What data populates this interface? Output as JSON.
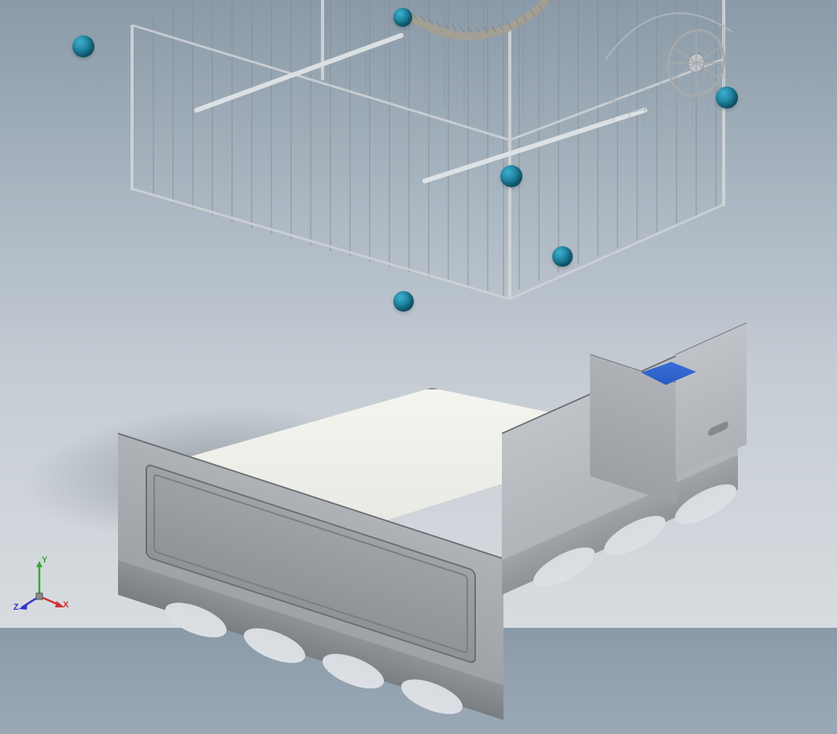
{
  "viewport": {
    "background_top": "#8a9aa8",
    "background_bottom": "#d8dce0"
  },
  "model": {
    "name": "bird-cage-assembly",
    "base_color": "#9ca0a4",
    "sphere_color": "#1a7a95",
    "bath_water_color": "#2050b8",
    "tray_color": "#f5f5f0"
  },
  "triad": {
    "x_label": "X",
    "y_label": "Y",
    "z_label": "Z",
    "x_color": "#cc3333",
    "y_color": "#33aa33",
    "z_color": "#3333cc"
  }
}
